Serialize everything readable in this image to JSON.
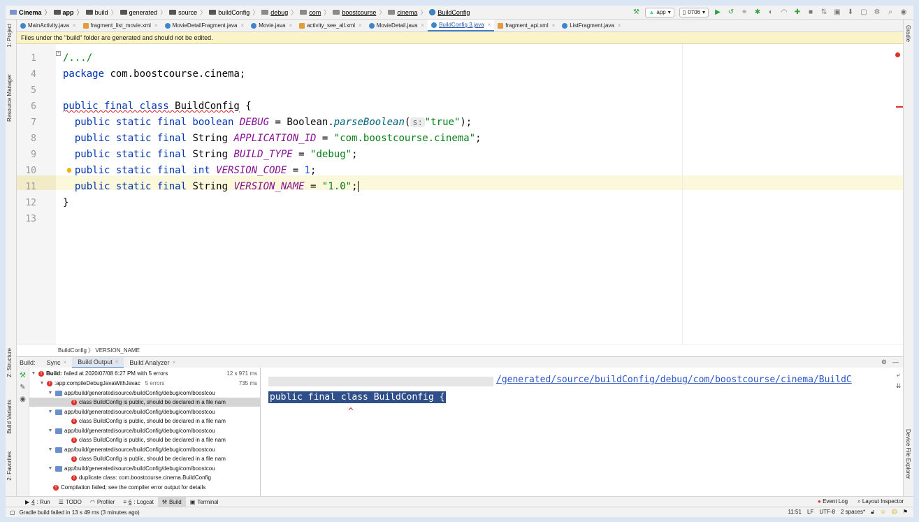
{
  "nav": {
    "crumbs": [
      "Cinema",
      "app",
      "build",
      "generated",
      "source",
      "buildConfig",
      "debug",
      "com",
      "boostcourse",
      "cinema",
      "BuildConfig"
    ],
    "run_config": "app",
    "device": "0706"
  },
  "tabs": [
    {
      "label": "MainActivity.java",
      "kind": "java"
    },
    {
      "label": "fragment_list_movie.xml",
      "kind": "xml"
    },
    {
      "label": "MovieDetailFragment.java",
      "kind": "java"
    },
    {
      "label": "Movie.java",
      "kind": "java"
    },
    {
      "label": "activity_see_all.xml",
      "kind": "xml"
    },
    {
      "label": "MovieDetail.java",
      "kind": "java"
    },
    {
      "label": "BuildConfig 3.java",
      "kind": "java",
      "active": true
    },
    {
      "label": "fragment_api.xml",
      "kind": "xml"
    },
    {
      "label": "ListFragment.java",
      "kind": "java"
    }
  ],
  "banner": "Files under the \"build\" folder are generated and should not be edited.",
  "editor": {
    "line_numbers": [
      "1",
      "4",
      "5",
      "6",
      "7",
      "8",
      "9",
      "10",
      "11",
      "12",
      "13"
    ],
    "l1": "/.../",
    "l4_kw": "package",
    "l4_txt": " com.boostcourse.cinema;",
    "l6_a": "public final class",
    "l6_b": " BuildConfig",
    "l6_c": " {",
    "l7_kw": "  public static final boolean ",
    "l7_fld": "DEBUG",
    "l7_eq": " = Boolean.",
    "l7_mth": "parseBoolean",
    "l7_p": "(",
    "l7_hint": "s:",
    "l7_str": "\"true\"",
    "l7_end": ");",
    "l8_kw": "  public static final ",
    "l8_type": "String ",
    "l8_fld": "APPLICATION_ID",
    "l8_eq": " = ",
    "l8_str": "\"com.boostcourse.cinema\"",
    "l8_end": ";",
    "l9_kw": "  public static final ",
    "l9_type": "String ",
    "l9_fld": "BUILD_TYPE",
    "l9_eq": " = ",
    "l9_str": "\"debug\"",
    "l9_end": ";",
    "l10_kw": "  public static final int ",
    "l10_fld": "VERSION_CODE",
    "l10_eq": " = ",
    "l10_num": "1",
    "l10_end": ";",
    "l11_kw": "  public static final ",
    "l11_type": "String ",
    "l11_fld": "VERSION_NAME",
    "l11_eq": " = ",
    "l11_str": "\"1.0\"",
    "l11_end": ";",
    "l12": "}"
  },
  "breadcrumb": "BuildConfig 〉 VERSION_NAME",
  "build": {
    "title": "Build:",
    "tabs": [
      "Sync",
      "Build Output",
      "Build Analyzer"
    ],
    "tree": {
      "root_bold": "Build:",
      "root_rest": "failed at 2020/07/08 6:27 PM with 5 errors",
      "root_time": "12 s 971 ms",
      "task": ":app:compileDebugJavaWithJavac",
      "task_errors": "5 errors",
      "task_time": "735 ms",
      "file": "app/build/generated/source/buildConfig/debug/com/boostcou",
      "err_public": "class BuildConfig is public, should be declared in a file nam",
      "err_dup": "duplicate class: com.boostcourse.cinema.BuildConfig",
      "failed": "Compilation failed; see the compiler error output for details"
    },
    "output": {
      "path": "/generated/source/buildConfig/debug/com/boostcourse/cinema/BuildC",
      "code": "public final class BuildConfig {",
      "caret": "^"
    }
  },
  "left_tools": [
    "1: Project",
    "Resource Manager",
    "Z: Structure",
    "Build Variants",
    "2: Favorites"
  ],
  "right_tools": [
    "Gradle",
    "Device File Explorer"
  ],
  "bottom_tools": [
    {
      "n": "4",
      "label": ": Run"
    },
    {
      "n": "",
      "label": "TODO"
    },
    {
      "n": "",
      "label": "Profiler"
    },
    {
      "n": "6",
      "label": ": Logcat"
    },
    {
      "n": "",
      "label": "Build",
      "active": true
    },
    {
      "n": "",
      "label": "Terminal"
    }
  ],
  "bottom_right": [
    "Event Log",
    "Layout Inspector"
  ],
  "status": {
    "msg": "Gradle build failed in 13 s 49 ms (3 minutes ago)",
    "pos": "11:51",
    "lf": "LF",
    "enc": "UTF-8",
    "indent": "2 spaces*"
  }
}
